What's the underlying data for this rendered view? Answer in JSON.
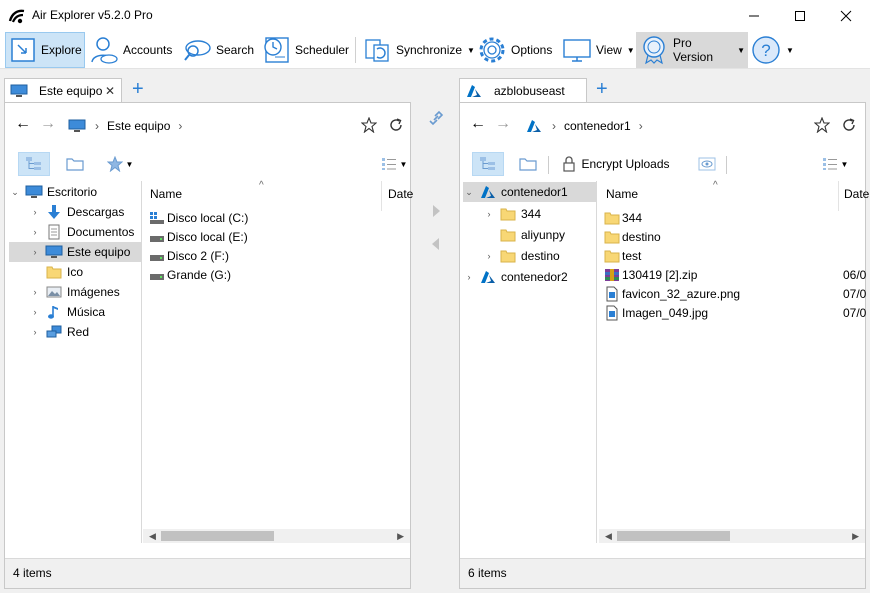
{
  "window": {
    "title": "Air Explorer v5.2.0 Pro"
  },
  "ribbon": {
    "explore": "Explore",
    "accounts": "Accounts",
    "search": "Search",
    "scheduler": "Scheduler",
    "synchronize": "Synchronize",
    "options": "Options",
    "view": "View",
    "pro_version": "Pro Version"
  },
  "left": {
    "tab_label": "Este equipo",
    "breadcrumb": "Este equipo",
    "tree": [
      {
        "label": "Escritorio",
        "icon": "desktop-icon"
      },
      {
        "label": "Descargas",
        "icon": "download-arrow-icon"
      },
      {
        "label": "Documentos",
        "icon": "document-icon"
      },
      {
        "label": "Este equipo",
        "icon": "monitor-icon"
      },
      {
        "label": "Ico",
        "icon": "folder-icon"
      },
      {
        "label": "Imágenes",
        "icon": "pictures-icon"
      },
      {
        "label": "Música",
        "icon": "music-note-icon"
      },
      {
        "label": "Red",
        "icon": "network-icon"
      }
    ],
    "columns": {
      "name": "Name",
      "date": "Date"
    },
    "rows": [
      {
        "name": "Disco local (C:)",
        "icon": "system-drive-icon"
      },
      {
        "name": "Disco local (E:)",
        "icon": "drive-icon"
      },
      {
        "name": "Disco 2 (F:)",
        "icon": "drive-icon"
      },
      {
        "name": "Grande (G:)",
        "icon": "drive-icon"
      }
    ],
    "status": "4 items"
  },
  "right": {
    "tab_label": "azblobuseast",
    "breadcrumb": "contenedor1",
    "encrypt_uploads": "Encrypt Uploads",
    "tree": [
      {
        "label": "contenedor1",
        "icon": "azure-icon"
      },
      {
        "label": "344",
        "icon": "folder-icon"
      },
      {
        "label": "aliyunpy",
        "icon": "folder-icon"
      },
      {
        "label": "destino",
        "icon": "folder-icon"
      },
      {
        "label": "contenedor2",
        "icon": "azure-icon"
      }
    ],
    "columns": {
      "name": "Name",
      "date": "Date"
    },
    "rows": [
      {
        "name": "344",
        "date": "",
        "icon": "folder-icon"
      },
      {
        "name": "destino",
        "date": "",
        "icon": "folder-icon"
      },
      {
        "name": "test",
        "date": "",
        "icon": "folder-icon"
      },
      {
        "name": "130419 [2].zip",
        "date": "06/0",
        "icon": "zip-archive-icon"
      },
      {
        "name": "favicon_32_azure.png",
        "date": "07/0",
        "icon": "image-file-icon"
      },
      {
        "name": "Imagen_049.jpg",
        "date": "07/0",
        "icon": "image-file-icon"
      }
    ],
    "status": "6 items"
  },
  "colors": {
    "accent": "#2a7fd4",
    "selection": "#cce4f7",
    "folder": "#f8d775",
    "azure": "#0072c6"
  }
}
